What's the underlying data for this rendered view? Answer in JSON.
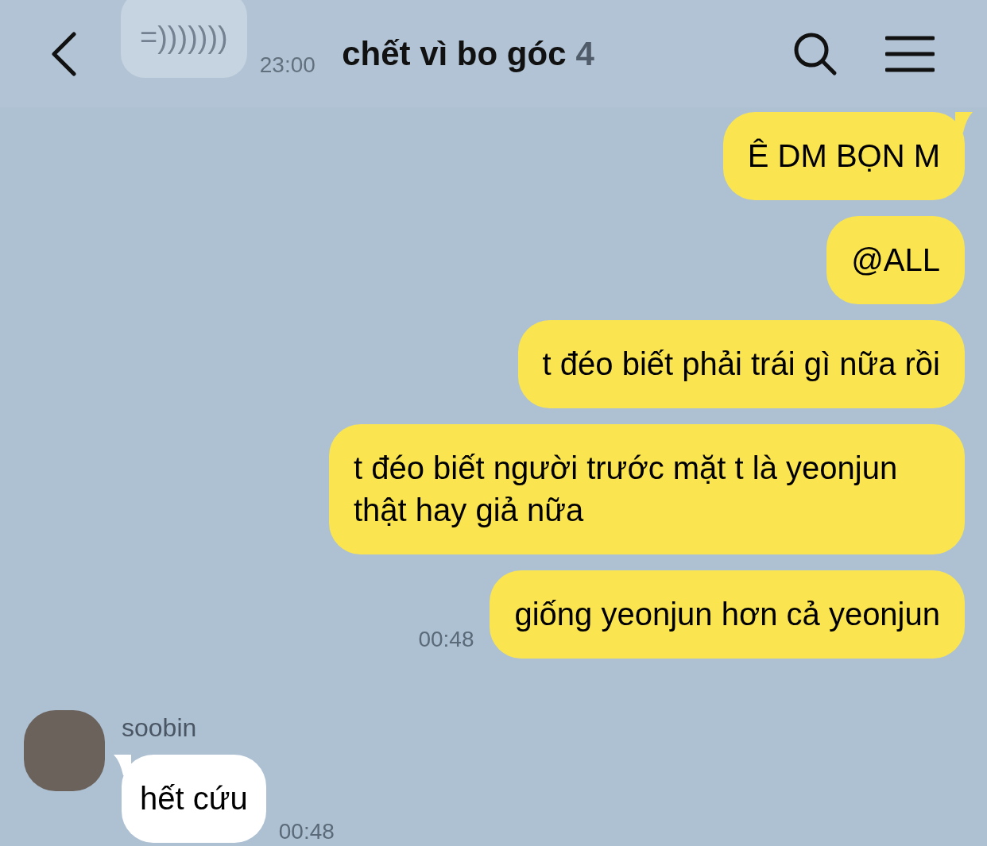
{
  "header": {
    "title": "chết vì bo góc",
    "member_count": "4"
  },
  "previous_message": {
    "text": "=)))))))",
    "time": "23:00"
  },
  "messages": [
    {
      "kind": "out",
      "text": "Ê DM BỌN M",
      "tail": true
    },
    {
      "kind": "out",
      "text": "@ALL",
      "tail": false
    },
    {
      "kind": "out",
      "text": "t đéo biết phải trái gì nữa rồi",
      "tail": false
    },
    {
      "kind": "out",
      "text": "t đéo biết người trước mặt t là yeonjun thật hay giả nữa",
      "tail": false
    },
    {
      "kind": "out",
      "text": "giống yeonjun hơn cả yeonjun",
      "tail": false,
      "time": "00:48"
    },
    {
      "kind": "in",
      "sender": "soobin",
      "text": "hết cứu",
      "tail": true,
      "time": "00:48"
    }
  ]
}
